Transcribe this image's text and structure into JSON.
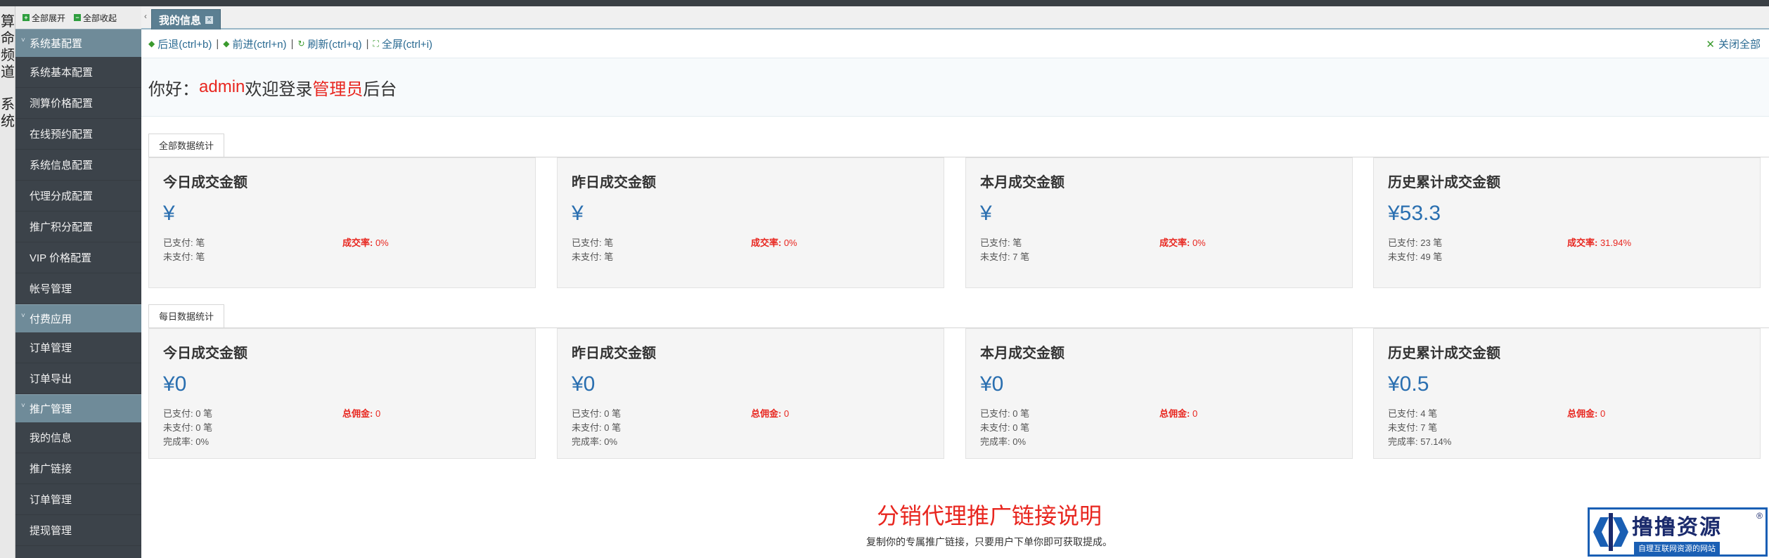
{
  "left_strip": {
    "group1": [
      "算",
      "命",
      "频",
      "道"
    ],
    "group2": [
      "系",
      "统"
    ]
  },
  "sidebar": {
    "expand_all": "全部展开",
    "collapse_all": "全部收起",
    "groups": [
      {
        "label": "系统基配置",
        "items": [
          "系统基本配置",
          "测算价格配置",
          "在线预约配置",
          "系统信息配置",
          "代理分成配置",
          "推广积分配置",
          "VIP 价格配置",
          "帐号管理"
        ]
      },
      {
        "label": "付费应用",
        "items": [
          "订单管理",
          "订单导出"
        ]
      },
      {
        "label": "推广管理",
        "items": [
          "我的信息",
          "推广链接",
          "订单管理",
          "提现管理"
        ]
      }
    ]
  },
  "tabs": {
    "active": "我的信息"
  },
  "toolbar": {
    "back": "后退(ctrl+b)",
    "forward": "前进(ctrl+n)",
    "refresh": "刷新(ctrl+q)",
    "fullscreen": "全屏(ctrl+i)",
    "close_all": "关闭全部"
  },
  "welcome": {
    "prefix": "你好：",
    "user": "admin",
    "middle": "欢迎登录",
    "role": "管理员",
    "suffix": "后台"
  },
  "sections": [
    {
      "tab": "全部数据统计",
      "cards": [
        {
          "title": "今日成交金额",
          "amount": "¥",
          "lines": [
            "已支付: 笔",
            "未支付: 笔"
          ],
          "right_label": "成交率:",
          "right_value": " 0%"
        },
        {
          "title": "昨日成交金额",
          "amount": "¥",
          "lines": [
            "已支付: 笔",
            "未支付: 笔"
          ],
          "right_label": "成交率:",
          "right_value": " 0%"
        },
        {
          "title": "本月成交金额",
          "amount": "¥",
          "lines": [
            "已支付: 笔",
            "未支付: 7 笔"
          ],
          "right_label": "成交率:",
          "right_value": " 0%"
        },
        {
          "title": "历史累计成交金额",
          "amount": "¥53.3",
          "lines": [
            "已支付: 23 笔",
            "未支付: 49 笔"
          ],
          "right_label": "成交率:",
          "right_value": " 31.94%"
        }
      ]
    },
    {
      "tab": "每日数据统计",
      "cards": [
        {
          "title": "今日成交金额",
          "amount": "¥0",
          "lines": [
            "已支付: 0 笔",
            "未支付: 0 笔",
            "完成率: 0%"
          ],
          "right_label": "总佣金:",
          "right_value": " 0"
        },
        {
          "title": "昨日成交金额",
          "amount": "¥0",
          "lines": [
            "已支付: 0 笔",
            "未支付: 0 笔",
            "完成率: 0%"
          ],
          "right_label": "总佣金:",
          "right_value": " 0"
        },
        {
          "title": "本月成交金额",
          "amount": "¥0",
          "lines": [
            "已支付: 0 笔",
            "未支付: 0 笔",
            "完成率: 0%"
          ],
          "right_label": "总佣金:",
          "right_value": " 0"
        },
        {
          "title": "历史累计成交金额",
          "amount": "¥0.5",
          "lines": [
            "已支付: 4 笔",
            "未支付: 7 笔",
            "完成率: 57.14%"
          ],
          "right_label": "总佣金:",
          "right_value": " 0"
        }
      ]
    }
  ],
  "footer": {
    "title": "分销代理推广链接说明",
    "subtitle": "复制你的专属推广链接，只要用户下单你即可获取提成。"
  },
  "watermark": {
    "name": "撸撸资源",
    "tagline": "自理互联网资源的网站",
    "reg": "®"
  },
  "colors": {
    "accent_red": "#e8261f",
    "amount_blue": "#2a6fb0",
    "sidebar_bg": "#3c434a",
    "group_bg": "#6f8b99"
  }
}
